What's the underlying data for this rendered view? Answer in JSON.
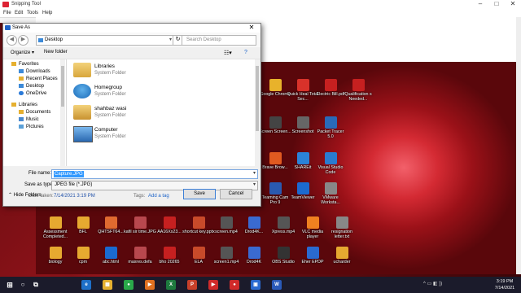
{
  "snipping_tool": {
    "title": "Snipping Tool",
    "menu": [
      "File",
      "Edit",
      "Tools",
      "Help"
    ]
  },
  "dialog": {
    "title": "Save As",
    "address": "Desktop",
    "search_placeholder": "Search Desktop",
    "toolbar": {
      "organize": "Organize ▾",
      "new_folder": "New folder"
    },
    "nav": {
      "favorites": "Favorites",
      "favorites_items": [
        "Downloads",
        "Recent Places",
        "Desktop",
        "OneDrive"
      ],
      "libraries": "Libraries",
      "libraries_items": [
        "Documents",
        "Music",
        "Pictures"
      ]
    },
    "items": [
      {
        "name": "Libraries",
        "type": "System Folder",
        "icon": "libraries-icon"
      },
      {
        "name": "Homegroup",
        "type": "System Folder",
        "icon": "homegroup-icon"
      },
      {
        "name": "shahbaz wasi",
        "type": "System Folder",
        "icon": "user-folder-icon"
      },
      {
        "name": "Computer",
        "type": "System Folder",
        "icon": "computer-icon"
      }
    ],
    "file_name_label": "File name:",
    "file_name_value": "Capture.JPG",
    "save_type_label": "Save as type:",
    "save_type_value": "JPEG file (*.JPG)",
    "date_taken_label": "Date taken:",
    "date_taken_value": "7/14/2021 3:19 PM",
    "tags_label": "Tags:",
    "tags_value": "Add a tag",
    "hide_folders": "Hide Folders",
    "save_button": "Save",
    "cancel_button": "Cancel"
  },
  "desktop_icons_right": [
    {
      "label": "Google Chrome",
      "color": "#e8b22b"
    },
    {
      "label": "Quick Heal Total Sec...",
      "color": "#d8322a"
    },
    {
      "label": "Electric Bill.pdf",
      "color": "#c62020"
    },
    {
      "label": "Qualification s Needed...",
      "color": "#c62020"
    },
    {
      "label": "Screen Screen...",
      "color": "#444"
    },
    {
      "label": "Screenshot",
      "color": "#666"
    },
    {
      "label": "Packet Tracer 5.0",
      "color": "#2a6ab8"
    },
    {
      "label": "Brave Brow...",
      "color": "#e05a20"
    },
    {
      "label": "SHAREit",
      "color": "#2b83d8"
    },
    {
      "label": "Visual Studio Code",
      "color": "#2a7bd0"
    },
    {
      "label": "Teaming Cam Pro 9",
      "color": "#2a5ab0"
    },
    {
      "label": "TeamViewer",
      "color": "#1c6ad0"
    },
    {
      "label": "VMware Worksta...",
      "color": "#888"
    }
  ],
  "desktop_icons_bottom": [
    {
      "label": "Assessment Completed...",
      "color": "#e6a930"
    },
    {
      "label": "BFL",
      "color": "#e6a930"
    },
    {
      "label": "QHTSFT64...",
      "color": "#e06a30"
    },
    {
      "label": "kafil sir time.JPG",
      "color": "#b8484e"
    },
    {
      "label": "AA16Xx23...",
      "color": "#c62020"
    },
    {
      "label": "shortcut key.pptx",
      "color": "#c84a2a"
    },
    {
      "label": "screen.mp4",
      "color": "#555"
    },
    {
      "label": "Drod4K...",
      "color": "#3a6ad0"
    },
    {
      "label": "Xpress.mp4",
      "color": "#555"
    },
    {
      "label": "VLC media player",
      "color": "#f08020"
    },
    {
      "label": "resignation letter.txt",
      "color": "#888"
    },
    {
      "label": "biology",
      "color": "#e6a930"
    },
    {
      "label": "cpm",
      "color": "#e6a930"
    },
    {
      "label": "abc.html",
      "color": "#1a6ad0"
    },
    {
      "label": "maxres.defa",
      "color": "#b8484e"
    },
    {
      "label": "bho 20265",
      "color": "#c62020"
    },
    {
      "label": "ELA",
      "color": "#c84a2a"
    },
    {
      "label": "screen1.mp4",
      "color": "#555"
    },
    {
      "label": "Drod4K",
      "color": "#3a6ad0"
    },
    {
      "label": "OBS Studio",
      "color": "#333"
    },
    {
      "label": "Eher EPDP",
      "color": "#2a6ad0"
    },
    {
      "label": "ucharder",
      "color": "#e6a930"
    }
  ],
  "taskbar": {
    "time": "3:19 PM",
    "date": "7/14/2021",
    "apps": [
      {
        "letter": "e",
        "color": "#1e70c8"
      },
      {
        "letter": "▦",
        "color": "#e6b030"
      },
      {
        "letter": "●",
        "color": "#2aa84a"
      },
      {
        "letter": "▶",
        "color": "#e07020"
      },
      {
        "letter": "X",
        "color": "#1e7a3e"
      },
      {
        "letter": "P",
        "color": "#c8402a"
      },
      {
        "letter": "▶",
        "color": "#d02a2a"
      },
      {
        "letter": "●",
        "color": "#d02a2a"
      },
      {
        "letter": "▣",
        "color": "#2a6ad0"
      },
      {
        "letter": "W",
        "color": "#2a5ab8"
      }
    ]
  }
}
